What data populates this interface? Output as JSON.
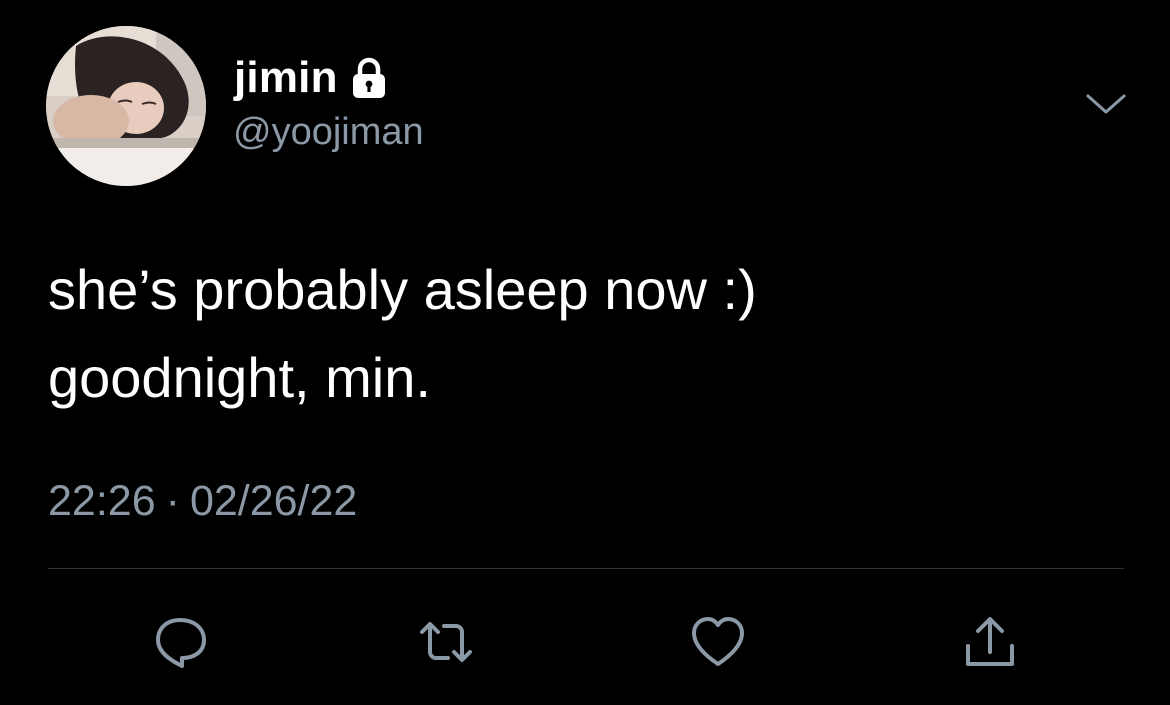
{
  "user": {
    "display_name": "jimin",
    "handle": "@yoojiman",
    "protected_icon": "lock-icon",
    "avatar_icon": "profile-photo"
  },
  "tweet": {
    "lines": [
      "she’s probably asleep now :)",
      "goodnight, min."
    ],
    "time": "22:26",
    "separator": "·",
    "date": "02/26/22"
  },
  "menu": {
    "icon": "chevron-down-icon"
  },
  "actions": [
    {
      "name": "reply",
      "icon": "reply-icon"
    },
    {
      "name": "retweet",
      "icon": "retweet-icon"
    },
    {
      "name": "like",
      "icon": "heart-icon"
    },
    {
      "name": "share",
      "icon": "share-icon"
    }
  ],
  "colors": {
    "background": "#000000",
    "primary_text": "#ffffff",
    "secondary_text": "#8b98a5",
    "divider": "#2f3336",
    "icon": "#8b98a5"
  }
}
